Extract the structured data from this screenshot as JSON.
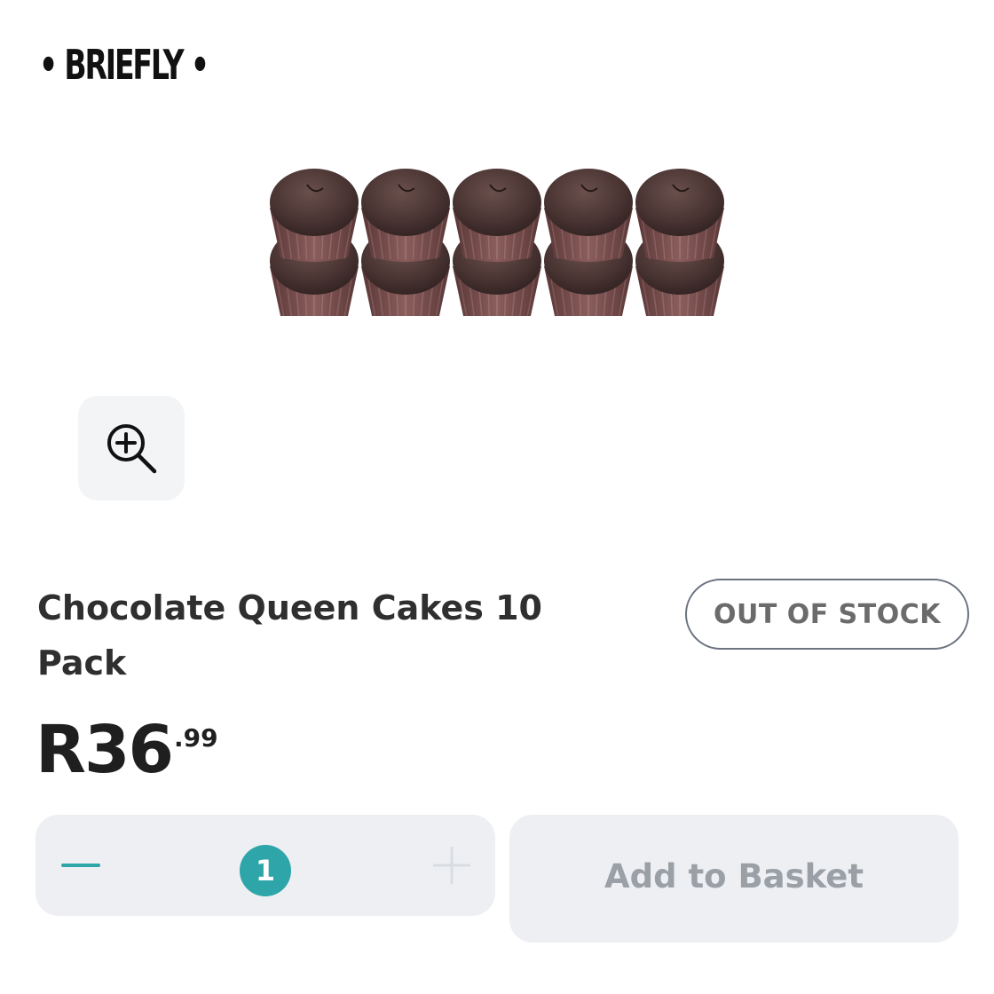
{
  "watermark": "• BRIEFLY •",
  "product": {
    "title": "Chocolate Queen Cakes 10 Pack",
    "stock_status": "OUT OF STOCK",
    "price_main": "R36",
    "price_cents": ".99",
    "image_icon": "muffin-tray-image"
  },
  "controls": {
    "zoom_icon": "zoom-in-icon",
    "minus_icon": "minus-icon",
    "plus_icon": "plus-icon",
    "quantity": "1",
    "add_to_basket_label": "Add to Basket"
  },
  "colors": {
    "accent": "#2ea5a9",
    "button_bg": "#edeff3",
    "disabled_text": "#9aa0a6",
    "muffin": "#4a3533",
    "liner": "#6b4444"
  }
}
